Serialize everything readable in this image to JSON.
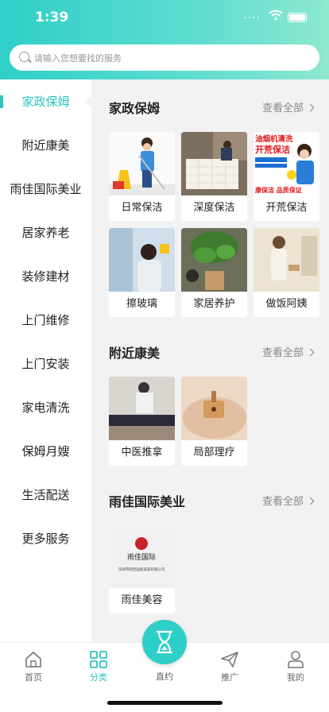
{
  "status_bar": {
    "time": "1:39"
  },
  "search": {
    "placeholder": "请输入您想要找的服务"
  },
  "sidebar": {
    "items": [
      {
        "label": "家政保姆",
        "active": true
      },
      {
        "label": "附近康美"
      },
      {
        "label": "雨佳国际美业"
      },
      {
        "label": "居家养老"
      },
      {
        "label": "装修建材"
      },
      {
        "label": "上门维修"
      },
      {
        "label": "上门安装"
      },
      {
        "label": "家电清洗"
      },
      {
        "label": "保姆月嫂"
      },
      {
        "label": "生活配送"
      },
      {
        "label": "更多服务"
      }
    ]
  },
  "sections": [
    {
      "title": "家政保姆",
      "more": "查看全部",
      "items": [
        {
          "label": "日常保洁"
        },
        {
          "label": "深度保洁"
        },
        {
          "label": "开荒保洁",
          "image_text": {
            "top": "油烟机清洗",
            "mid": "开荒保洁",
            "bottom": "康保洁 品质保证"
          }
        },
        {
          "label": "擦玻璃"
        },
        {
          "label": "家居养护"
        },
        {
          "label": "做饭阿姨"
        }
      ]
    },
    {
      "title": "附近康美",
      "more": "查看全部",
      "items": [
        {
          "label": "中医推拿"
        },
        {
          "label": "局部理疗"
        }
      ]
    },
    {
      "title": "雨佳国际美业",
      "more": "查看全部",
      "items": [
        {
          "label": "雨佳美容",
          "image_text": {
            "logo": "雨佳国际",
            "company": "深圳市雨佳国际美容有限公司"
          }
        }
      ]
    }
  ],
  "tabbar": {
    "items": [
      {
        "label": "首页",
        "icon": "home-icon"
      },
      {
        "label": "分类",
        "icon": "category-icon",
        "active": true
      },
      {
        "label": "直约",
        "icon": "hourglass-icon"
      },
      {
        "label": "推广",
        "icon": "send-icon"
      },
      {
        "label": "我的",
        "icon": "user-icon"
      }
    ]
  },
  "colors": {
    "accent": "#2cc4bd",
    "header_start": "#2ecfc8",
    "header_end": "#8de8cf"
  }
}
